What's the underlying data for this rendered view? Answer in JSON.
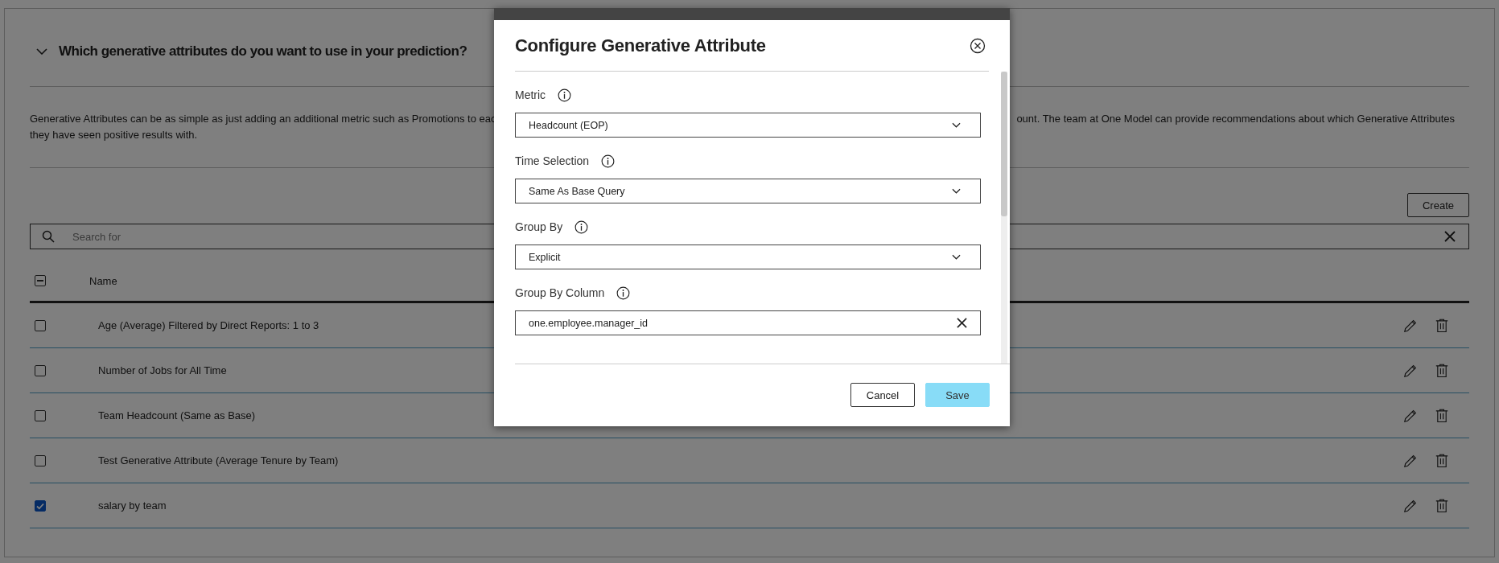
{
  "section": {
    "expanded": true,
    "title": "Which generative attributes do you want to use in your prediction?",
    "description_fragments": [
      "Generative Attributes can be as simple as just adding an additional metric such as Promotions to eac",
      "ount. The team at One Model can provide recommendations about which Generative Attributes",
      "they have seen positive results with."
    ]
  },
  "create_button": "Create",
  "search": {
    "placeholder": "Search for"
  },
  "table": {
    "select_all": {
      "indeterminate": true
    },
    "columns": [
      "Name"
    ],
    "rows": [
      {
        "name": "Age (Average) Filtered by Direct Reports: 1 to 3",
        "checked": false
      },
      {
        "name": "Number of Jobs for All Time",
        "checked": false
      },
      {
        "name": "Team Headcount (Same as Base)",
        "checked": false
      },
      {
        "name": "Test Generative Attribute (Average Tenure by Team)",
        "checked": false
      },
      {
        "name": "salary by team",
        "checked": true
      }
    ]
  },
  "modal": {
    "title": "Configure Generative Attribute",
    "fields": [
      {
        "label": "Metric",
        "kind": "select",
        "value": "Headcount (EOP)"
      },
      {
        "label": "Time Selection",
        "kind": "select",
        "value": "Same As Base Query"
      },
      {
        "label": "Group By",
        "kind": "select",
        "value": "Explicit"
      },
      {
        "label": "Group By Column",
        "kind": "text",
        "value": "one.employee.manager_id"
      }
    ],
    "cancel_button": "Cancel",
    "save_button": "Save"
  }
}
